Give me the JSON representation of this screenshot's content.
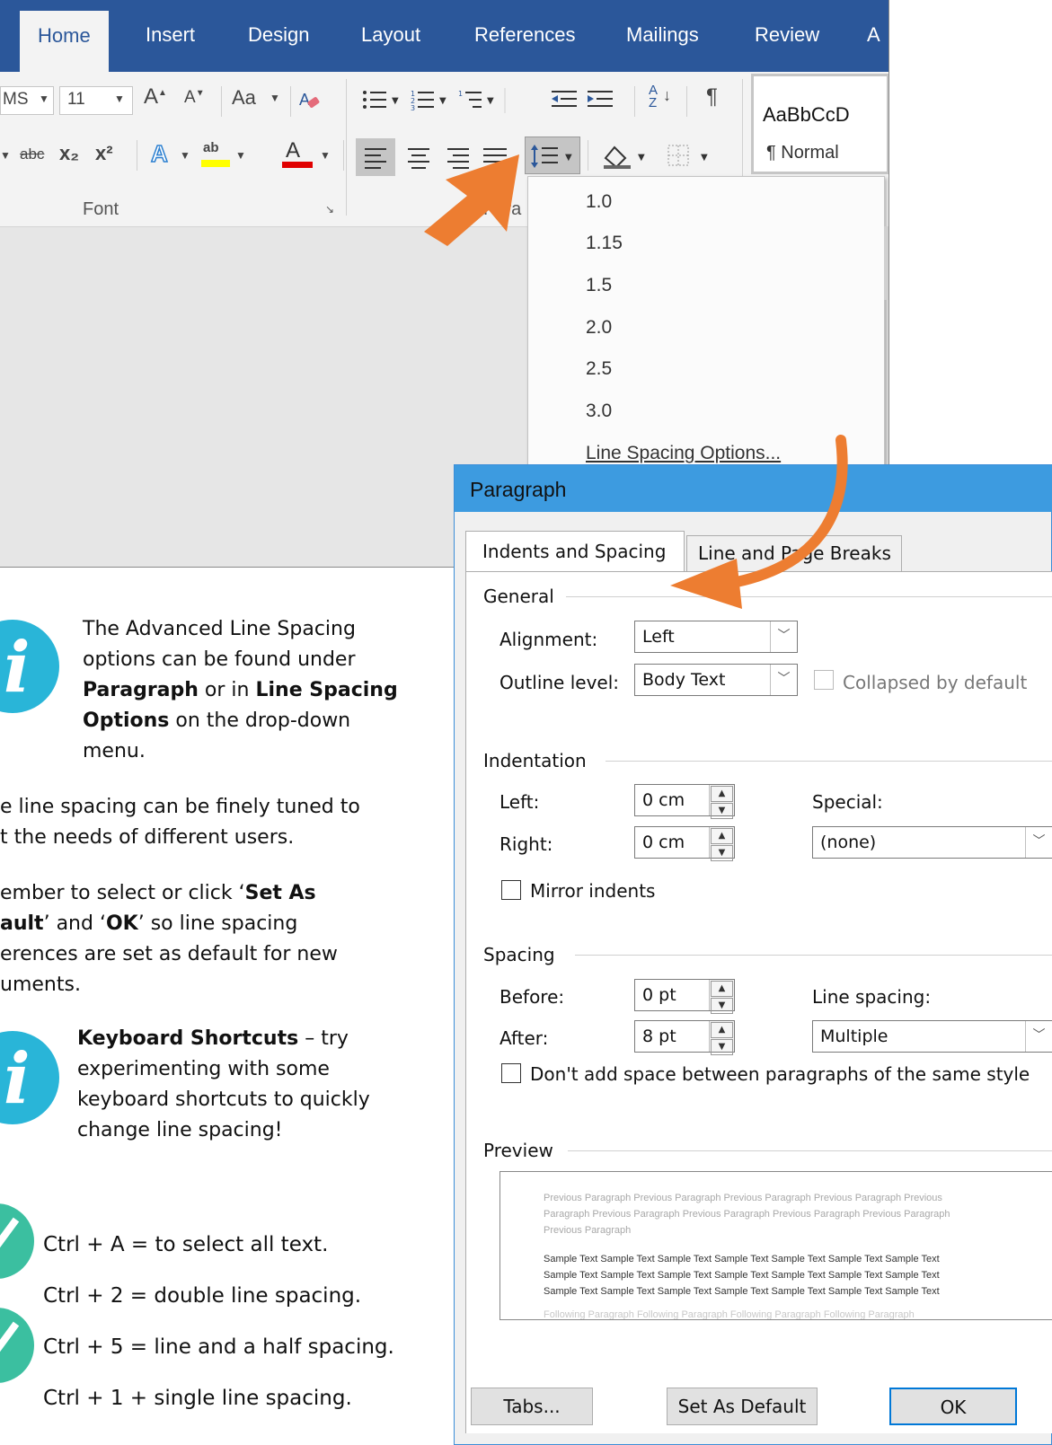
{
  "word": {
    "tabs": [
      "Home",
      "Insert",
      "Design",
      "Layout",
      "References",
      "Mailings",
      "Review",
      "A"
    ],
    "font_name_partial": "MS",
    "font_size": "11",
    "change_case_label": "Aa",
    "styles_preview": "AaBbCcD",
    "style_name": "¶ Normal",
    "group_font_label": "Font",
    "group_paragraph_partial": "Para",
    "strike_label": "abc",
    "sub_label": "x₂",
    "sup_label": "x²",
    "pilcrow": "¶",
    "sort_label": "A↓Z"
  },
  "line_spacing_menu": {
    "items": [
      "1.0",
      "1.15",
      "1.5",
      "2.0",
      "2.5",
      "3.0"
    ],
    "options_label": "Line Spacing Options..."
  },
  "dialog": {
    "title": "Paragraph",
    "tabs": [
      "Indents and Spacing",
      "Line and Page Breaks"
    ],
    "general": {
      "heading": "General",
      "alignment_label": "Alignment:",
      "alignment_value": "Left",
      "outline_label": "Outline level:",
      "outline_value": "Body Text",
      "collapsed_label": "Collapsed by default"
    },
    "indentation": {
      "heading": "Indentation",
      "left_label": "Left:",
      "left_value": "0 cm",
      "right_label": "Right:",
      "right_value": "0 cm",
      "special_label": "Special:",
      "special_value": "(none)",
      "mirror_label": "Mirror indents"
    },
    "spacing": {
      "heading": "Spacing",
      "before_label": "Before:",
      "before_value": "0 pt",
      "after_label": "After:",
      "after_value": "8 pt",
      "line_spacing_label": "Line spacing:",
      "line_spacing_value": "Multiple",
      "dont_add_label": "Don't add space between paragraphs of the same style"
    },
    "preview": {
      "heading": "Preview",
      "prev_line1": "Previous Paragraph Previous Paragraph Previous Paragraph Previous Paragraph Previous",
      "prev_line2": "Paragraph Previous Paragraph Previous Paragraph Previous Paragraph Previous Paragraph",
      "prev_line3": "Previous Paragraph",
      "sample_line1": "Sample Text Sample Text Sample Text Sample Text Sample Text Sample Text Sample Text",
      "sample_line2": "Sample Text Sample Text Sample Text Sample Text Sample Text Sample Text Sample Text",
      "sample_line3": "Sample Text Sample Text Sample Text Sample Text Sample Text Sample Text Sample Text",
      "follow_line1": "Following Paragraph Following Paragraph Following Paragraph Following Paragraph"
    },
    "buttons": {
      "tabs": "Tabs...",
      "set_default": "Set As Default",
      "ok": "OK"
    }
  },
  "info": {
    "tip1_line1": "The Advanced Line Spacing",
    "tip1_line2": "options can be found under",
    "tip1_bold1": "Paragraph",
    "tip1_mid": " or in ",
    "tip1_bold2": "Line Spacing",
    "tip1_bold3": "Options",
    "tip1_line4_rest": " on the drop-down",
    "tip1_line5": "menu.",
    "para1_line1": "e line spacing can be finely tuned to",
    "para1_line2": "t the needs of different users.",
    "para2_line1_a": "ember to select or click ‘",
    "para2_line1_b": "Set As",
    "para2_line2_a": "ault",
    "para2_line2_b": "’ and ‘",
    "para2_line2_c": "OK",
    "para2_line2_d": "’ so line spacing",
    "para2_line3": "erences are set as default for new",
    "para2_line4": "uments.",
    "tip2_bold": "Keyboard Shortcuts",
    "tip2_rest": " – try",
    "tip2_line2": "experimenting with some",
    "tip2_line3": "keyboard shortcuts to quickly",
    "tip2_line4": "change line spacing!",
    "shortcuts": [
      "Ctrl + A = to select all text.",
      "Ctrl + 2 = double line spacing.",
      "Ctrl + 5 = line and a half spacing.",
      "Ctrl + 1 + single line spacing."
    ],
    "icon_letter": "i"
  },
  "colors": {
    "word_blue": "#2b579a",
    "dialog_title": "#3d9be0",
    "arrow_orange": "#ed7d31",
    "info_blue": "#29b5d8",
    "info_teal": "#3bbfa0"
  }
}
